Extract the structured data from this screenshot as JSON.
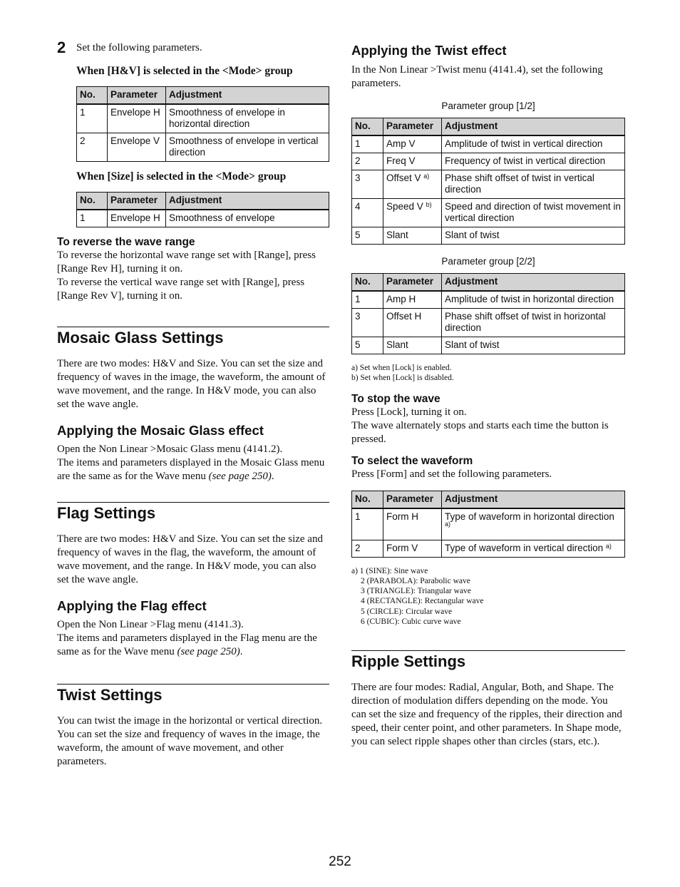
{
  "left_column": {
    "step": {
      "number": "2",
      "text": "Set the following parameters."
    },
    "hv_mode": {
      "heading": "When [H&V] is selected in the <Mode> group",
      "table": {
        "headers": [
          "No.",
          "Parameter",
          "Adjustment"
        ],
        "rows": [
          {
            "no": "1",
            "param": "Envelope H",
            "adj": "Smoothness of envelope in horizontal direction"
          },
          {
            "no": "2",
            "param": "Envelope V",
            "adj": "Smoothness of envelope in vertical direction"
          }
        ]
      }
    },
    "size_mode": {
      "heading": "When [Size] is selected in the <Mode> group",
      "table": {
        "headers": [
          "No.",
          "Parameter",
          "Adjustment"
        ],
        "rows": [
          {
            "no": "1",
            "param": "Envelope H",
            "adj": "Smoothness of envelope"
          }
        ]
      }
    },
    "reverse_range": {
      "heading": "To reverse the wave range",
      "line1": "To reverse the horizontal wave range set with [Range], press [Range Rev H], turning it on.",
      "line2": "To reverse the vertical wave range set with [Range], press [Range Rev V], turning it on."
    },
    "mosaic_glass": {
      "title": "Mosaic Glass Settings",
      "body": "There are two modes: H&V and Size. You can set the size and frequency of waves in the image, the waveform, the amount of wave movement, and the range. In H&V mode, you can also set the wave angle.",
      "apply_heading": "Applying the Mosaic Glass effect",
      "apply_line1": "Open the Non Linear >Mosaic Glass menu (4141.2).",
      "apply_line2": "The items and parameters displayed in the Mosaic Glass menu are the same as for the Wave menu",
      "apply_ref": "(see page 250)",
      "apply_end": "."
    },
    "flag": {
      "title": "Flag Settings",
      "body": "There are two modes: H&V and Size. You can set the size and frequency of waves in the flag, the waveform, the amount of wave movement, and the range. In H&V mode, you can also set the wave angle.",
      "apply_heading": "Applying the Flag effect",
      "apply_line1": "Open the Non Linear >Flag menu (4141.3).",
      "apply_line2": "The items and parameters displayed in the Flag menu are the same as for the Wave menu",
      "apply_ref": "(see page 250)",
      "apply_end": "."
    },
    "twist": {
      "title": "Twist Settings",
      "line1": "You can twist the image in the horizontal or vertical direction.",
      "line2": "You can set the size and frequency of waves in the image, the waveform, the amount of wave movement, and other parameters."
    }
  },
  "right_column": {
    "apply_twist": {
      "heading": "Applying the Twist effect",
      "intro": "In the Non Linear >Twist menu (4141.4), set the following parameters.",
      "group1": {
        "caption": "Parameter group [1/2]",
        "headers": [
          "No.",
          "Parameter",
          "Adjustment"
        ],
        "rows": [
          {
            "no": "1",
            "param": "Amp V",
            "sup": "",
            "adj": "Amplitude of twist in vertical direction"
          },
          {
            "no": "2",
            "param": "Freq V",
            "sup": "",
            "adj": "Frequency of twist in vertical direction"
          },
          {
            "no": "3",
            "param": "Offset V",
            "sup": "a)",
            "adj": "Phase shift offset of twist in vertical direction"
          },
          {
            "no": "4",
            "param": "Speed V",
            "sup": "b)",
            "adj": "Speed and direction of twist movement in vertical direction"
          },
          {
            "no": "5",
            "param": "Slant",
            "sup": "",
            "adj": "Slant of twist"
          }
        ]
      },
      "group2": {
        "caption": "Parameter group [2/2]",
        "headers": [
          "No.",
          "Parameter",
          "Adjustment"
        ],
        "rows": [
          {
            "no": "1",
            "param": "Amp H",
            "adj": "Amplitude of twist in horizontal direction"
          },
          {
            "no": "3",
            "param": "Offset H",
            "adj": "Phase shift offset of twist in horizontal direction"
          },
          {
            "no": "5",
            "param": "Slant",
            "adj": "Slant of twist"
          }
        ]
      },
      "footnotes": [
        "a) Set when [Lock] is enabled.",
        "b) Set when [Lock] is disabled."
      ]
    },
    "stop_wave": {
      "heading": "To stop the wave",
      "line1": "Press [Lock], turning it on.",
      "line2": "The wave alternately stops and starts each time the button is pressed."
    },
    "select_waveform": {
      "heading": "To select the waveform",
      "intro": "Press [Form] and set the following parameters.",
      "table": {
        "headers": [
          "No.",
          "Parameter",
          "Adjustment"
        ],
        "rows": [
          {
            "no": "1",
            "param": "Form H",
            "adj": "Type of waveform in horizontal direction",
            "sup": "a)"
          },
          {
            "no": "2",
            "param": "Form V",
            "adj": "Type of waveform in vertical direction",
            "sup": "a)"
          }
        ]
      },
      "footnote_lines": [
        "a) 1 (SINE): Sine wave",
        "2 (PARABOLA): Parabolic wave",
        "3 (TRIANGLE): Triangular wave",
        "4 (RECTANGLE): Rectangular wave",
        "5 (CIRCLE): Circular wave",
        "6 (CUBIC): Cubic curve wave"
      ]
    },
    "ripple": {
      "title": "Ripple Settings",
      "body": "There are four modes: Radial, Angular, Both, and Shape. The direction of modulation differs depending on the mode. You can set the size and frequency of the ripples, their direction and speed, their center point, and other parameters. In Shape mode, you can select ripple shapes other than circles (stars, etc.)."
    }
  },
  "page_number": "252"
}
